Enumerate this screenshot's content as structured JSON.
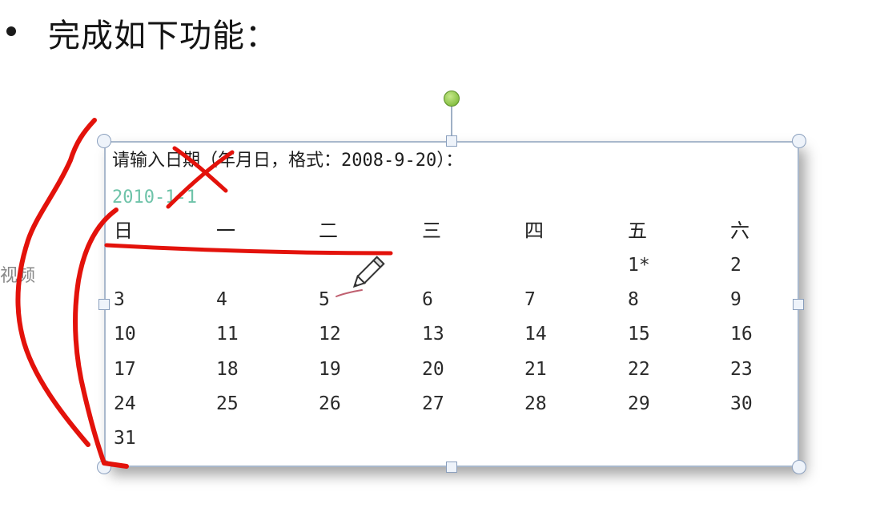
{
  "slide": {
    "title": "完成如下功能：",
    "side_text": "视频"
  },
  "console": {
    "prompt": "请输入日期（年月日，格式：2008-9-20）：",
    "input_value": "2010-1-1"
  },
  "calendar": {
    "weekday_headers": [
      "日",
      "一",
      "二",
      "三",
      "四",
      "五",
      "六"
    ],
    "rows": [
      [
        "",
        "",
        "",
        "",
        "",
        "1*",
        "2"
      ],
      [
        "3",
        "4",
        "5",
        "6",
        "7",
        "8",
        "9"
      ],
      [
        "10",
        "11",
        "12",
        "13",
        "14",
        "15",
        "16"
      ],
      [
        "17",
        "18",
        "19",
        "20",
        "21",
        "22",
        "23"
      ],
      [
        "24",
        "25",
        "26",
        "27",
        "28",
        "29",
        "30"
      ],
      [
        "31",
        "",
        "",
        "",
        "",
        "",
        ""
      ]
    ]
  },
  "colors": {
    "input_text": "#6ec3a9",
    "annotation_ink": "#e3120b",
    "rotate_handle": "#6fb02a",
    "frame_border": "#a9b8cc"
  },
  "icons": [
    "bullet-icon",
    "rotate-handle-icon",
    "pencil-cursor-icon"
  ]
}
